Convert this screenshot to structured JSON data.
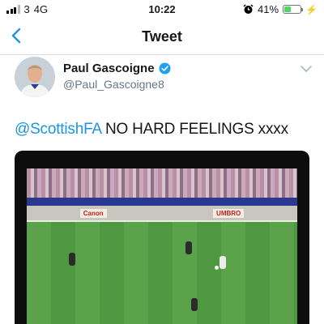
{
  "status_bar": {
    "carrier": "3",
    "network": "4G",
    "time": "10:22",
    "battery_text": "41%",
    "battery_level": 0.41,
    "icons": [
      "signal-bars",
      "alarm-clock",
      "battery",
      "charging-bolt"
    ],
    "colors": {
      "battery_fill": "#4cd964"
    }
  },
  "nav": {
    "title": "Tweet",
    "back_icon": "chevron-left",
    "accent": "#1b95e0"
  },
  "tweet": {
    "author_name": "Paul Gascoigne",
    "author_handle": "@Paul_Gascoigne8",
    "verified": true,
    "mention": "@ScottishFA",
    "text": " NO HARD FEELINGS xxxx",
    "colors": {
      "mention": "#1b95e0",
      "verified": "#1da1f2"
    }
  },
  "video": {
    "ad_boards": [
      "Canon",
      "UMBRO"
    ]
  }
}
